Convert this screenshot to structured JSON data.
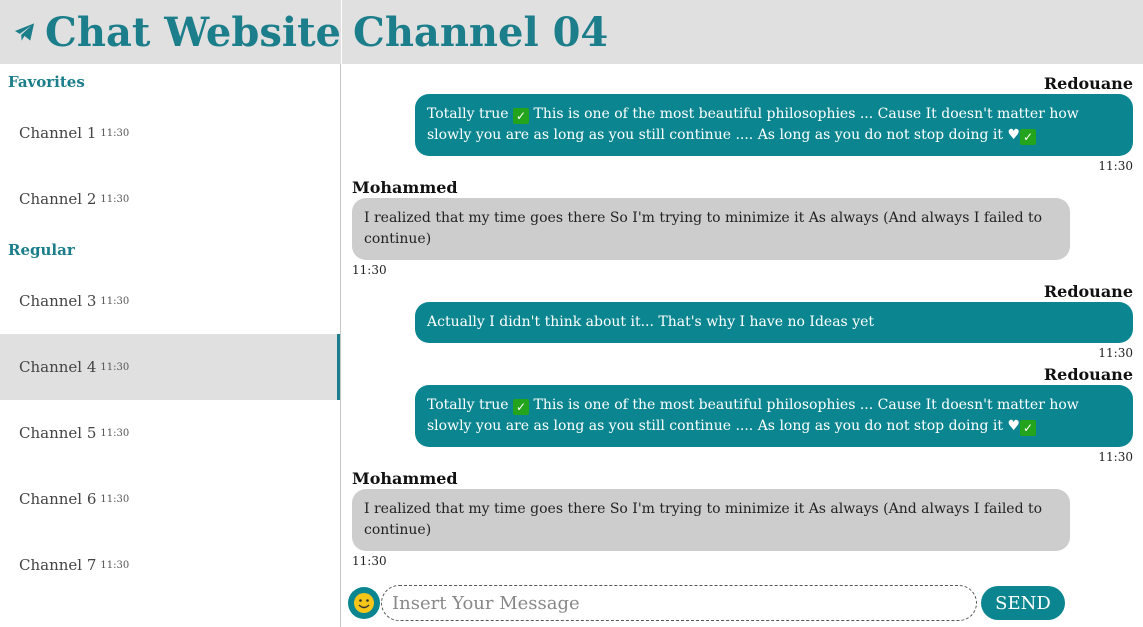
{
  "header": {
    "app_title": "Chat Website",
    "logo_icon": "paper-plane-icon",
    "channel_title": "Channel 04"
  },
  "colors": {
    "accent": "#1b7e8a",
    "bubble_mine": "#0b8690",
    "bubble_theirs": "#cdcdcd",
    "header_bg": "#e0e0e0"
  },
  "sidebar": {
    "groups": [
      {
        "label": "Favorites",
        "channels": [
          {
            "name": "Channel 1",
            "time": "11:30"
          },
          {
            "name": "Channel 2",
            "time": "11:30"
          }
        ]
      },
      {
        "label": "Regular",
        "channels": [
          {
            "name": "Channel 3",
            "time": "11:30"
          },
          {
            "name": "Channel 4",
            "time": "11:30",
            "active": true
          },
          {
            "name": "Channel 5",
            "time": "11:30"
          },
          {
            "name": "Channel 6",
            "time": "11:30"
          },
          {
            "name": "Channel 7",
            "time": "11:30"
          }
        ]
      }
    ]
  },
  "messages": [
    {
      "sender": "Redouane",
      "mine": true,
      "segments": [
        "Totally true ",
        "✓",
        " This is one of the most beautiful philosophies ... Cause It doesn't matter how slowly you are as long as you still continue .... As long as you do not stop doing it ",
        "♥",
        "✓"
      ],
      "time": "11:30"
    },
    {
      "sender": "Mohammed",
      "mine": false,
      "segments": [
        "I realized that my time goes there So I'm trying to minimize it As always (And always I failed to continue)"
      ],
      "time": "11:30"
    },
    {
      "sender": "Redouane",
      "mine": true,
      "segments": [
        "Actually I didn't think about it... That's why I have no Ideas yet"
      ],
      "time": "11:30"
    },
    {
      "sender": "Redouane",
      "mine": true,
      "segments": [
        "Totally true ",
        "✓",
        " This is one of the most beautiful philosophies ... Cause It doesn't matter how slowly you are as long as you still continue .... As long as you do not stop doing it ",
        "♥",
        "✓"
      ],
      "time": "11:30"
    },
    {
      "sender": "Mohammed",
      "mine": false,
      "segments": [
        "I realized that my time goes there So I'm trying to minimize it As always (And always I failed to continue)"
      ],
      "time": "11:30"
    }
  ],
  "composer": {
    "emoji_icon": "smiley-icon",
    "placeholder": "Insert Your Message",
    "value": "",
    "send_label": "SEND"
  }
}
